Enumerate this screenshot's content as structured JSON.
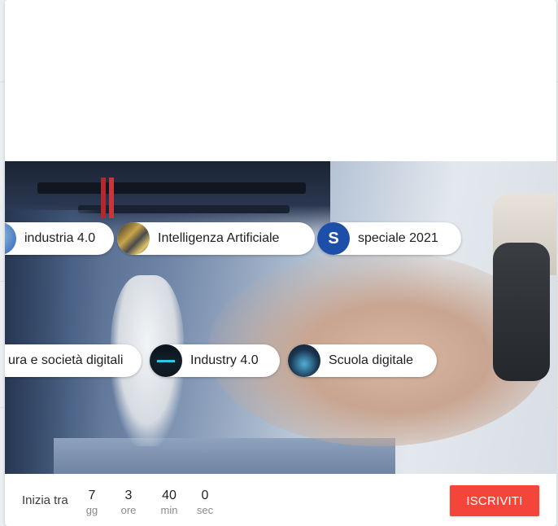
{
  "tags_row1": [
    {
      "label": "industria 4.0",
      "icon": "industria-avatar"
    },
    {
      "label": "Intelligenza Artificiale",
      "icon": "ai-avatar"
    },
    {
      "label": "speciale 2021",
      "icon": "letter-s-avatar",
      "avatar_letter": "S"
    }
  ],
  "tags_row2": [
    {
      "label": "ura e società digitali",
      "icon": "cultura-avatar"
    },
    {
      "label": "Industry 4.0",
      "icon": "industry-avatar"
    },
    {
      "label": "Scuola digitale",
      "icon": "scuola-avatar"
    }
  ],
  "countdown": {
    "label": "Inizia tra",
    "days": {
      "value": "7",
      "unit": "gg"
    },
    "hours": {
      "value": "3",
      "unit": "ore"
    },
    "minutes": {
      "value": "40",
      "unit": "min"
    },
    "seconds": {
      "value": "0",
      "unit": "sec"
    }
  },
  "cta": {
    "label": "ISCRIVITI",
    "color": "#f4453a"
  },
  "colors": {
    "accent": "#f4453a",
    "badge_s": "#1e4fa8"
  }
}
